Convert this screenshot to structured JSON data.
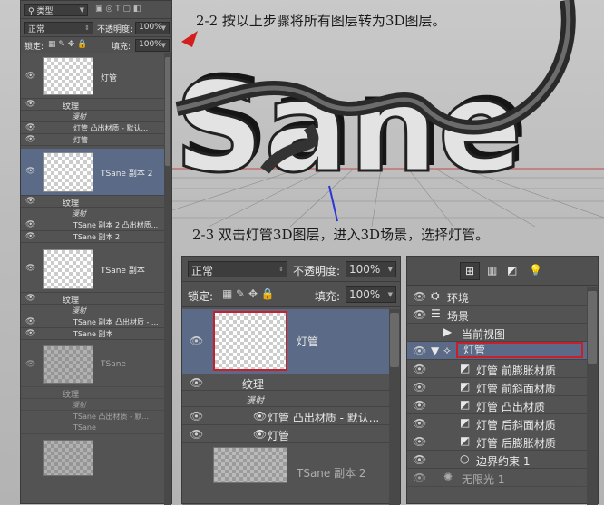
{
  "captions": {
    "step1": "2-2 按以上步骤将所有图层转为3D图层。",
    "step2": "2-3 双击灯管3D图层，进入3D场景，选择灯管。"
  },
  "artwork": {
    "word": "Sane"
  },
  "left_panel": {
    "filter_label": "类型",
    "blend_mode": "正常",
    "opacity_label": "不透明度:",
    "opacity_value": "100%",
    "lock_label": "锁定:",
    "fill_label": "填充:",
    "fill_value": "100%",
    "layers": [
      {
        "name": "灯管",
        "sub": [
          {
            "label": "纹理"
          },
          {
            "label": "漫射",
            "italic": true
          },
          {
            "label": "灯管 凸出材质 - 默认..."
          },
          {
            "label": "灯管"
          }
        ]
      },
      {
        "name": "TSane 副本 2",
        "selected": true,
        "sub": [
          {
            "label": "纹理"
          },
          {
            "label": "漫射",
            "italic": true
          },
          {
            "label": "TSane 副本 2 凸出材质..."
          },
          {
            "label": "TSane 副本 2"
          }
        ]
      },
      {
        "name": "TSane 副本",
        "sub": [
          {
            "label": "纹理"
          },
          {
            "label": "漫射",
            "italic": true
          },
          {
            "label": "TSane 副本 凸出材质 - ..."
          },
          {
            "label": "TSane 副本"
          }
        ]
      },
      {
        "name": "TSane",
        "sub": [
          {
            "label": "纹理"
          },
          {
            "label": "漫射",
            "italic": true
          },
          {
            "label": "TSane 凸出材质 - 默..."
          },
          {
            "label": "TSane"
          }
        ]
      }
    ]
  },
  "mid_panel": {
    "blend_mode": "正常",
    "opacity_label": "不透明度:",
    "opacity_value": "100%",
    "lock_label": "锁定:",
    "fill_label": "填充:",
    "fill_value": "100%",
    "layer_name": "灯管",
    "sub": [
      {
        "label": "纹理"
      },
      {
        "label": "漫射",
        "italic": true
      },
      {
        "label": "灯管 凸出材质 - 默认..."
      },
      {
        "label": "灯管"
      }
    ],
    "next_layer": "TSane 副本 2"
  },
  "scene_panel": {
    "items": [
      {
        "label": "环境",
        "icon": "environment-icon",
        "indent": 0
      },
      {
        "label": "场景",
        "icon": "scene-icon",
        "indent": 0
      },
      {
        "label": "当前视图",
        "icon": "camera-icon",
        "indent": 1
      },
      {
        "label": "灯管",
        "icon": "mesh-icon",
        "indent": 1,
        "selected": true
      },
      {
        "label": "灯管 前膨胀材质",
        "icon": "material-icon",
        "indent": 2
      },
      {
        "label": "灯管 前斜面材质",
        "icon": "material-icon",
        "indent": 2
      },
      {
        "label": "灯管 凸出材质",
        "icon": "material-icon",
        "indent": 2
      },
      {
        "label": "灯管 后斜面材质",
        "icon": "material-icon",
        "indent": 2
      },
      {
        "label": "灯管 后膨胀材质",
        "icon": "material-icon",
        "indent": 2
      },
      {
        "label": "边界约束 1",
        "icon": "constraint-icon",
        "indent": 2
      },
      {
        "label": "无限光 1",
        "icon": "light-icon",
        "indent": 1
      }
    ]
  },
  "colors": {
    "accent_red": "#d21e1e",
    "selection": "#5b6a86",
    "panel_bg": "#535353"
  }
}
